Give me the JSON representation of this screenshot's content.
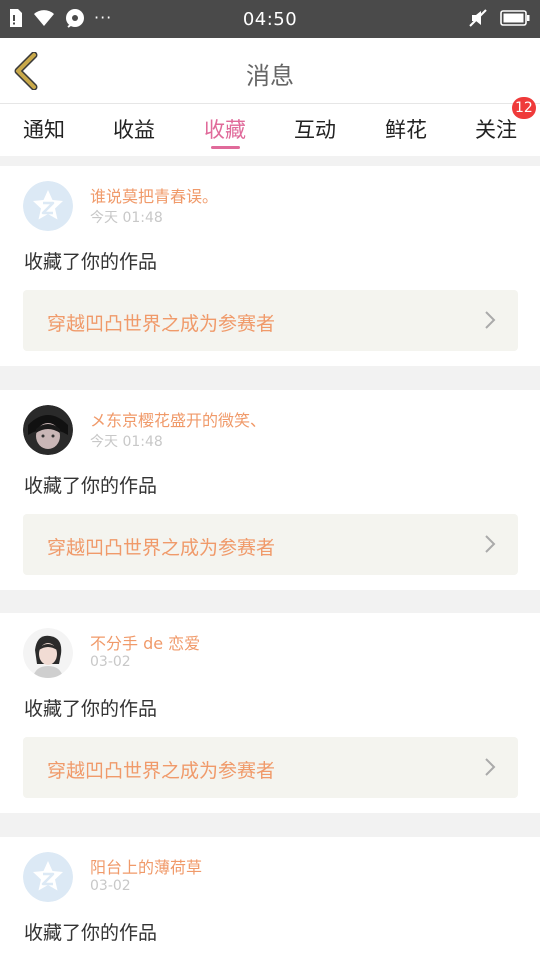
{
  "status_bar": {
    "time": "04:50",
    "dots": "···"
  },
  "header": {
    "title": "消息"
  },
  "tabs": [
    {
      "label": "通知"
    },
    {
      "label": "收益"
    },
    {
      "label": "收藏",
      "active": true
    },
    {
      "label": "互动"
    },
    {
      "label": "鲜花"
    },
    {
      "label": "关注",
      "badge": "12"
    }
  ],
  "notifications": [
    {
      "username": "谁说莫把青春误。",
      "time": "今天 01:48",
      "message": "收藏了你的作品",
      "work_title": "穿越凹凸世界之成为参赛者",
      "avatar": "default-avatar"
    },
    {
      "username": "メ东京樱花盛开的微笑、",
      "time": "今天 01:48",
      "message": "收藏了你的作品",
      "work_title": "穿越凹凸世界之成为参赛者",
      "avatar": "photo-avatar"
    },
    {
      "username": "不分手 de 恋爱",
      "time": "03-02",
      "message": "收藏了你的作品",
      "work_title": "穿越凹凸世界之成为参赛者",
      "avatar": "illustration-avatar"
    },
    {
      "username": "阳台上的薄荷草",
      "time": "03-02",
      "message": "收藏了你的作品",
      "work_title": "",
      "avatar": "default-avatar"
    }
  ],
  "colors": {
    "accent": "#e06a9a",
    "username": "#f09a6a",
    "badge": "#ef3a3a",
    "back_icon": "#c9a94a"
  }
}
